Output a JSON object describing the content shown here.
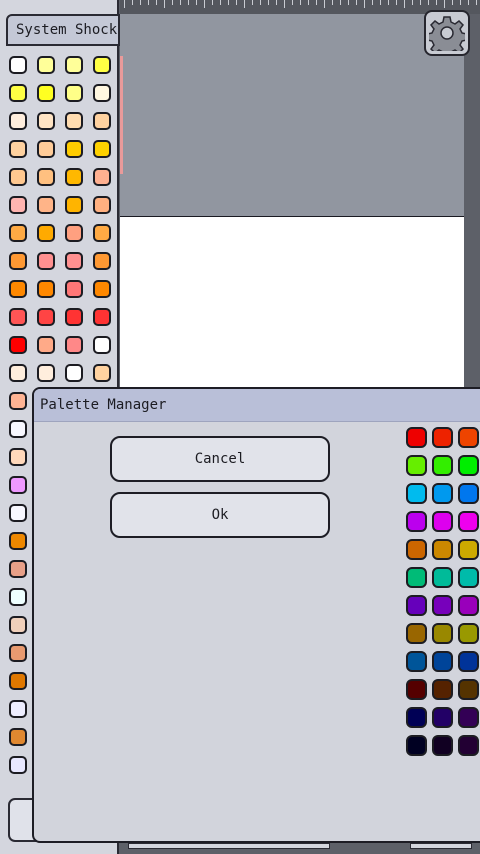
{
  "palette_panel": {
    "title": "System Shock",
    "swatch_colors": [
      [
        "#ffffff",
        "#ffff99",
        "#ffff99",
        "#ffff44"
      ],
      [
        "#ffff44",
        "#ffff22",
        "#ffff88",
        "#fff7e0"
      ],
      [
        "#ffeedd",
        "#ffe4c4",
        "#ffdcb0",
        "#ffd2a0"
      ],
      [
        "#ffd2a0",
        "#ffcc99",
        "#ffcc00",
        "#ffd200"
      ],
      [
        "#ffc890",
        "#ffc080",
        "#ffb800",
        "#ffb090"
      ],
      [
        "#ffb4b0",
        "#ffb488",
        "#ffb400",
        "#ffb080"
      ],
      [
        "#ffaa44",
        "#ffaa00",
        "#ffa080",
        "#ffaa44"
      ],
      [
        "#ff9933",
        "#ff9090",
        "#ff9090",
        "#ff9933"
      ],
      [
        "#ff8800",
        "#ff8800",
        "#ff7777",
        "#ff8800"
      ],
      [
        "#ff5555",
        "#ff4444",
        "#ff3333",
        "#ff3333"
      ],
      [
        "#ff0000",
        "#ffaa88",
        "#ff8888",
        "#ffffff"
      ],
      [
        "#ffeedd",
        "#ffeedd",
        "#ffffff",
        "#ffd2a0"
      ],
      [
        "#ffb494"
      ],
      [
        "#f8f8ff"
      ],
      [
        "#ffd8bb"
      ],
      [
        "#ee99ff"
      ],
      [
        "#f8f8ff"
      ],
      [
        "#ee8800"
      ],
      [
        "#e8a088"
      ],
      [
        "#eeffff"
      ],
      [
        "#f0d0bb"
      ],
      [
        "#e89a70"
      ],
      [
        "#e07800"
      ],
      [
        "#eeeeff"
      ],
      [
        "#e08830"
      ],
      [
        "#e8e8ff"
      ]
    ]
  },
  "palette_manager": {
    "title": "Palette Manager",
    "cancel_label": "Cancel",
    "ok_label": "Ok",
    "color_grid": [
      [
        "#ee0000",
        "#ee2200",
        "#ee4400"
      ],
      [
        "#66ee00",
        "#33ee00",
        "#00ee00"
      ],
      [
        "#00bbee",
        "#0099ee",
        "#0077ee"
      ],
      [
        "#bb00ee",
        "#dd00ee",
        "#ee00ee"
      ],
      [
        "#cc6600",
        "#cc8800",
        "#ccaa00"
      ],
      [
        "#00bb77",
        "#00bb99",
        "#00bbaa"
      ],
      [
        "#6600bb",
        "#7700bb",
        "#9900bb"
      ],
      [
        "#996600",
        "#998800",
        "#999900"
      ],
      [
        "#005599",
        "#004499",
        "#003399"
      ],
      [
        "#550000",
        "#552200",
        "#553300"
      ],
      [
        "#000055",
        "#220066",
        "#330055"
      ],
      [
        "#000022",
        "#110022",
        "#220033"
      ]
    ]
  },
  "toolbar": {
    "settings_icon": "gear-icon"
  }
}
